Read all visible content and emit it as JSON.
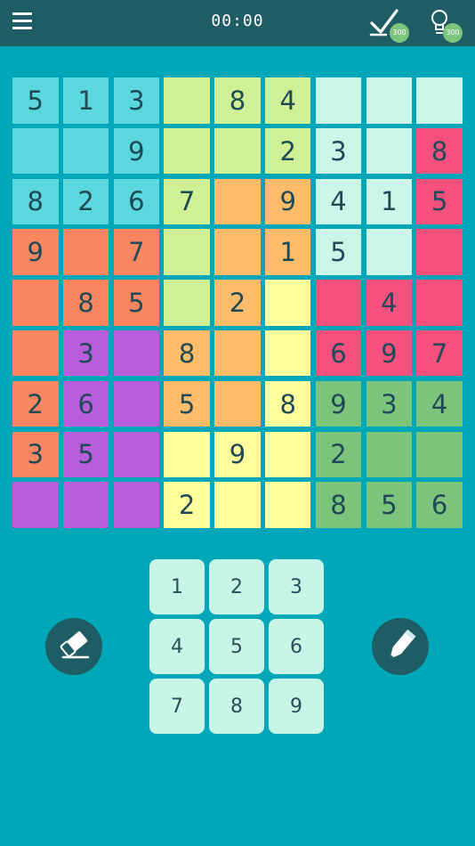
{
  "header": {
    "timer": "00:00",
    "check_badge": "300",
    "hint_badge": "300"
  },
  "icons": {
    "menu": "menu-icon",
    "check": "check-icon",
    "hint": "lightbulb-icon",
    "eraser": "eraser-icon",
    "pencil": "pencil-icon"
  },
  "colors": {
    "background": "#00a7b9",
    "topbar": "#1f5d65",
    "digit": "#1f4a55",
    "key_bg": "#c7f5e6",
    "badge": "#7fc47c",
    "teal": "#5ad8dd",
    "lime": "#cff095",
    "mint": "#ccf7e8",
    "pink": "#f6517e",
    "coral": "#f88761",
    "orange": "#fdbc6a",
    "yellow": "#ffff9e",
    "purple": "#b75ddc",
    "green": "#7cc47b"
  },
  "board": {
    "rows": [
      [
        "5",
        "1",
        "3",
        "",
        "8",
        "4",
        "",
        "",
        ""
      ],
      [
        "",
        "",
        "9",
        "",
        "",
        "2",
        "3",
        "",
        "8"
      ],
      [
        "8",
        "2",
        "6",
        "7",
        "",
        "9",
        "4",
        "1",
        "5"
      ],
      [
        "9",
        "",
        "7",
        "",
        "",
        "1",
        "5",
        "",
        ""
      ],
      [
        "",
        "8",
        "5",
        "",
        "2",
        "",
        "",
        "4",
        ""
      ],
      [
        "",
        "3",
        "",
        "8",
        "",
        "",
        "6",
        "9",
        "7"
      ],
      [
        "2",
        "6",
        "",
        "5",
        "",
        "8",
        "9",
        "3",
        "4"
      ],
      [
        "3",
        "5",
        "",
        "",
        "9",
        "",
        "2",
        "",
        ""
      ],
      [
        "",
        "",
        "",
        "2",
        "",
        "",
        "8",
        "5",
        "6"
      ]
    ],
    "regions": [
      [
        "teal",
        "teal",
        "teal",
        "lime",
        "lime",
        "lime",
        "mint",
        "mint",
        "mint"
      ],
      [
        "teal",
        "teal",
        "teal",
        "lime",
        "lime",
        "lime",
        "mint",
        "mint",
        "pink"
      ],
      [
        "teal",
        "teal",
        "teal",
        "lime",
        "orange",
        "orange",
        "mint",
        "mint",
        "pink"
      ],
      [
        "coral",
        "coral",
        "coral",
        "lime",
        "orange",
        "orange",
        "mint",
        "mint",
        "pink"
      ],
      [
        "coral",
        "coral",
        "coral",
        "lime",
        "orange",
        "yellow",
        "pink",
        "pink",
        "pink"
      ],
      [
        "coral",
        "purple",
        "purple",
        "orange",
        "orange",
        "yellow",
        "pink",
        "pink",
        "pink"
      ],
      [
        "coral",
        "purple",
        "purple",
        "orange",
        "orange",
        "yellow",
        "green",
        "green",
        "green"
      ],
      [
        "coral",
        "purple",
        "purple",
        "yellow",
        "yellow",
        "yellow",
        "green",
        "green",
        "green"
      ],
      [
        "purple",
        "purple",
        "purple",
        "yellow",
        "yellow",
        "yellow",
        "green",
        "green",
        "green"
      ]
    ]
  },
  "keypad": {
    "keys": [
      "1",
      "2",
      "3",
      "4",
      "5",
      "6",
      "7",
      "8",
      "9"
    ]
  }
}
